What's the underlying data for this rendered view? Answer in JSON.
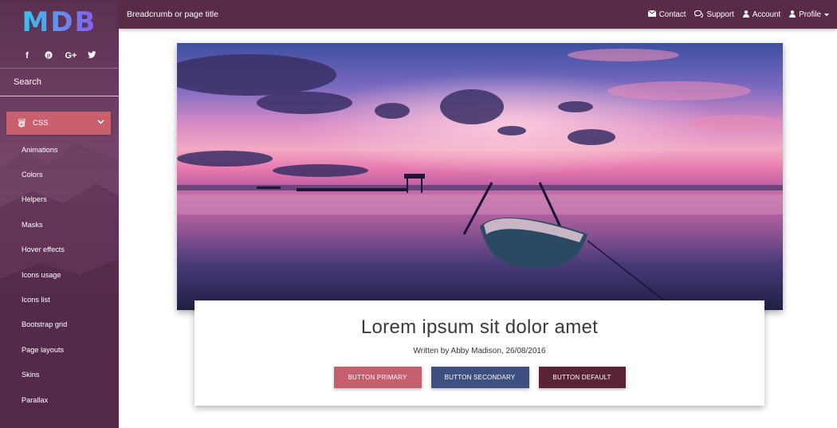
{
  "sidebar": {
    "logo": "MDB",
    "social": [
      "f",
      "p",
      "G+",
      "t"
    ],
    "search_label": "Search",
    "active_item": {
      "label": "CSS"
    },
    "items": [
      {
        "label": "Animations"
      },
      {
        "label": "Colors"
      },
      {
        "label": "Helpers"
      },
      {
        "label": "Masks"
      },
      {
        "label": "Hover effects"
      },
      {
        "label": "Icons usage"
      },
      {
        "label": "Icons list"
      },
      {
        "label": "Bootstrap grid"
      },
      {
        "label": "Page layouts"
      },
      {
        "label": "Skins"
      },
      {
        "label": "Parallax"
      }
    ]
  },
  "topbar": {
    "title": "Breadcrumb or page title",
    "nav": {
      "contact": "Contact",
      "support": "Support",
      "account": "Account",
      "profile": "Profile"
    }
  },
  "card": {
    "title": "Lorem ipsum sit dolor amet",
    "subtitle": "Written by Abby Madison, 26/08/2016",
    "buttons": {
      "primary": "BUTTON PRIMARY",
      "secondary": "BUTTON SECONDARY",
      "default": "BUTTON DEFAULT"
    }
  },
  "colors": {
    "topbar": "#5a2b47",
    "primary": "#c4606e",
    "secondary": "#3e5080",
    "default": "#5a2337"
  }
}
